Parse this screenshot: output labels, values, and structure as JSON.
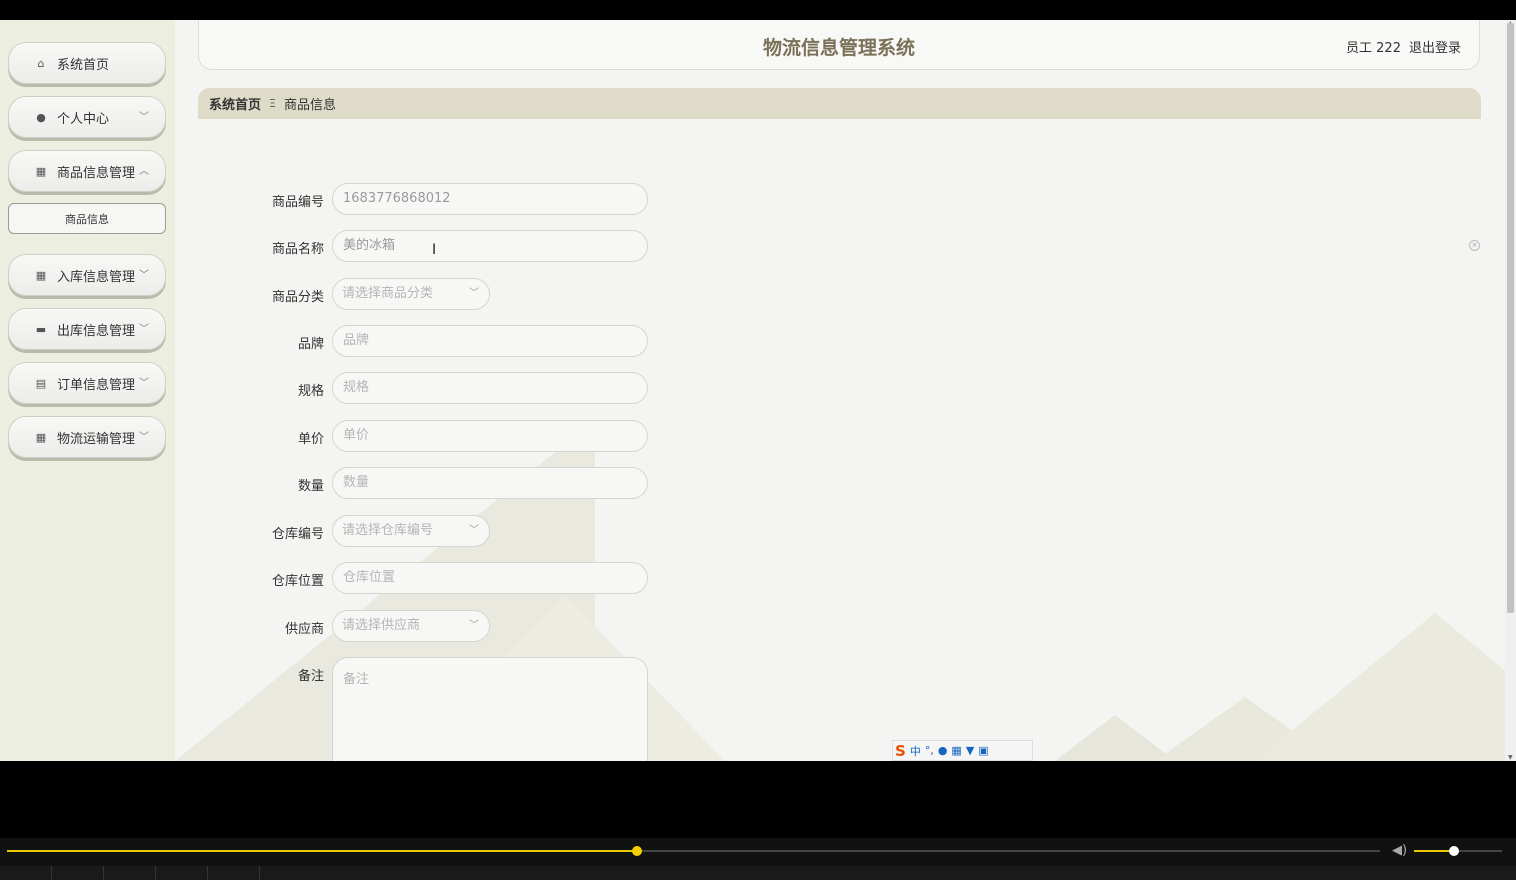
{
  "header": {
    "title": "物流信息管理系统",
    "user": "员工 222",
    "logout": "退出登录"
  },
  "sidebar": {
    "items": [
      {
        "label": "系统首页",
        "icon": "home-icon"
      },
      {
        "label": "个人中心",
        "icon": "user-icon"
      },
      {
        "label": "商品信息管理",
        "icon": "grid-icon"
      },
      {
        "label": "入库信息管理",
        "icon": "grid-icon"
      },
      {
        "label": "出库信息管理",
        "icon": "briefcase-icon"
      },
      {
        "label": "订单信息管理",
        "icon": "clipboard-icon"
      },
      {
        "label": "物流运输管理",
        "icon": "grid-icon"
      }
    ],
    "sub_item": "商品信息"
  },
  "breadcrumb": {
    "home": "系统首页",
    "separator": "Ξ",
    "current": "商品信息"
  },
  "form": {
    "code_label": "商品编号",
    "code_value": "1683776868012",
    "name_label": "商品名称",
    "name_value": "美的冰箱",
    "category_label": "商品分类",
    "category_placeholder": "请选择商品分类",
    "brand_label": "品牌",
    "brand_placeholder": "品牌",
    "spec_label": "规格",
    "spec_placeholder": "规格",
    "price_label": "单价",
    "price_placeholder": "单价",
    "qty_label": "数量",
    "qty_placeholder": "数量",
    "warehouse_no_label": "仓库编号",
    "warehouse_no_placeholder": "请选择仓库编号",
    "warehouse_loc_label": "仓库位置",
    "warehouse_loc_placeholder": "仓库位置",
    "supplier_label": "供应商",
    "supplier_placeholder": "请选择供应商",
    "remark_label": "备注",
    "remark_placeholder": "备注"
  },
  "ime": {
    "logo": "S",
    "mode": "中",
    "punct": "°,",
    "icons": [
      "mic-icon",
      "keyboard-icon",
      "shirt-icon",
      "apps-icon"
    ]
  },
  "player": {
    "progress": 0.459,
    "volume": 0.45
  },
  "colors": {
    "accent": "#e8c800",
    "title": "#7a7159",
    "breadcrumb_bg": "#dedcc8"
  }
}
